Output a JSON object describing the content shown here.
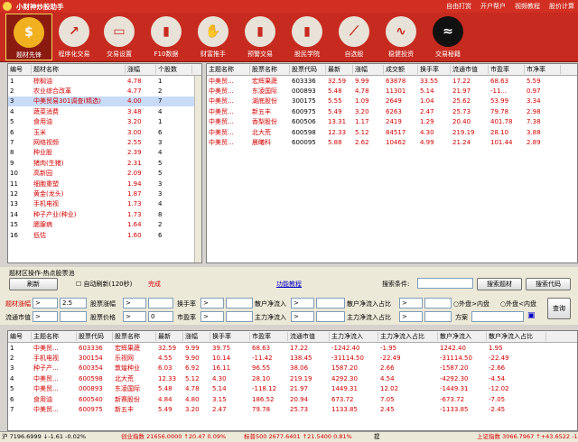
{
  "app": {
    "title": "小财神炒股助手",
    "links": [
      "自由打赏",
      "开户帮户",
      "视频教程",
      "股价计算"
    ]
  },
  "toolbar": [
    {
      "label": "题材先锋",
      "icon": "coin-icon",
      "active": true
    },
    {
      "label": "程序化交易",
      "icon": "chart-icon"
    },
    {
      "label": "交易设置",
      "icon": "monitor-icon"
    },
    {
      "label": "F10数据",
      "icon": "bar-chart-icon"
    },
    {
      "label": "财富推手",
      "icon": "hands-icon"
    },
    {
      "label": "预警交易",
      "icon": "bar-chart-icon"
    },
    {
      "label": "股民学院",
      "icon": "bar-chart-icon"
    },
    {
      "label": "自选股",
      "icon": "line-chart-icon"
    },
    {
      "label": "稳健投资",
      "icon": "pulse-icon"
    },
    {
      "label": "交易秘籍",
      "icon": "dark-chart-icon"
    }
  ],
  "left_table": {
    "headers": [
      "编号",
      "题材名称",
      "涨幅",
      "个股数"
    ],
    "rows": [
      [
        "1",
        "棕榈油",
        "4.78",
        "1"
      ],
      [
        "2",
        "农业综合改革",
        "4.77",
        "2"
      ],
      [
        "3",
        "中美贸易301调查(精选)",
        "4.00",
        "7"
      ],
      [
        "4",
        "蔬菜消费",
        "3.48",
        "4"
      ],
      [
        "5",
        "食用油",
        "3.20",
        "1"
      ],
      [
        "6",
        "玉米",
        "3.00",
        "6"
      ],
      [
        "7",
        "网络视频",
        "2.55",
        "3"
      ],
      [
        "8",
        "种业股",
        "2.39",
        "4"
      ],
      [
        "9",
        "猪肉(生猪)",
        "2.31",
        "5"
      ],
      [
        "10",
        "高新园",
        "2.09",
        "5"
      ],
      [
        "11",
        "细胞重塑",
        "1.94",
        "3"
      ],
      [
        "12",
        "黄金(龙头)",
        "1.87",
        "3"
      ],
      [
        "13",
        "手机电视",
        "1.73",
        "4"
      ],
      [
        "14",
        "种子产业(种业)",
        "1.73",
        "8"
      ],
      [
        "15",
        "腮腺病",
        "1.64",
        "2"
      ],
      [
        "16",
        "低估",
        "1.60",
        "6"
      ]
    ]
  },
  "right_table": {
    "headers": [
      "主题名称",
      "股票名称",
      "股票代码",
      "最新",
      "涨幅",
      "成交额",
      "换手率",
      "流通市值",
      "市盈率",
      "市净率"
    ],
    "rows": [
      [
        "中美贸...",
        "宏辉果蔬",
        "603336",
        "32.59",
        "9.99",
        "63878",
        "33.55",
        "17.22",
        "68.63",
        "5.59"
      ],
      [
        "中美贸...",
        "东凌国际",
        "000893",
        "5.48",
        "4.78",
        "11301",
        "5.14",
        "21.97",
        "-11...",
        "0.97"
      ],
      [
        "中美贸...",
        "湖底股份",
        "300175",
        "5.55",
        "1.09",
        "2649",
        "1.04",
        "25.62",
        "53.99",
        "3.34"
      ],
      [
        "中美贸...",
        "新五丰",
        "600975",
        "5.49",
        "3.20",
        "6263",
        "2.47",
        "25.73",
        "79.78",
        "2.98"
      ],
      [
        "中美贸...",
        "香梨股份",
        "600506",
        "13.31",
        "1.17",
        "2419",
        "1.29",
        "20.40",
        "401.78",
        "7.38"
      ],
      [
        "中美贸...",
        "北大荒",
        "600598",
        "12.33",
        "5.12",
        "84517",
        "4.30",
        "219.19",
        "28.10",
        "3.88"
      ],
      [
        "中美贸...",
        "晨曦科",
        "600095",
        "5.88",
        "2.62",
        "10462",
        "4.99",
        "21.24",
        "101.44",
        "2.89"
      ]
    ]
  },
  "controls": {
    "group_label": "题材区操作-热点股票池",
    "refresh": "刷新",
    "auto_refresh": "自动刷新(120秒)",
    "done": "完成",
    "func_desc": "功能教程",
    "search_label": "搜索条件:",
    "search_topic": "搜索题材",
    "search_code": "搜索代码",
    "query": "查询",
    "scheme": "方案"
  },
  "filters": {
    "row1": [
      "题材涨幅",
      "股票涨幅",
      "换手率",
      "散户净流入",
      "散户净流入占比"
    ],
    "row2": [
      "流通市值",
      "股票价格",
      "市盈率",
      "主力净流入",
      "主力净流入占比"
    ],
    "op": ">",
    "val": "2.5",
    "zero": "0",
    "ext": "外盘>内盘",
    "ext2": "外盘<内盘"
  },
  "bottom_table": {
    "headers": [
      "编号",
      "主题名称",
      "股票代码",
      "股票名称",
      "最新",
      "涨幅",
      "换手率",
      "市盈率",
      "流通市值",
      "主力净流入",
      "主力净流入占比",
      "散户净流入",
      "散户净流入占比"
    ],
    "rows": [
      [
        "1",
        "中美贸...",
        "603336",
        "宏辉果蔬",
        "32.59",
        "9.99",
        "39.75",
        "68.63",
        "17.22",
        "-1242.40",
        "-1.95",
        "1242.40",
        "1.95"
      ],
      [
        "2",
        "手机电视",
        "300154",
        "乐视网",
        "4.55",
        "9.90",
        "10.14",
        "-11.42",
        "138.45",
        "-31114.50",
        "-22.49",
        "-31114.50",
        "-22.49"
      ],
      [
        "3",
        "种子产...",
        "600354",
        "敦煌种业",
        "6.03",
        "6.92",
        "16.11",
        "96.55",
        "38.06",
        "1587.20",
        "2.66",
        "-1587.20",
        "-2.66"
      ],
      [
        "4",
        "中美贸...",
        "600598",
        "北大荒",
        "12.33",
        "5.12",
        "4.30",
        "28.10",
        "219.19",
        "4292.30",
        "4.54",
        "-4292.30",
        "-4.54"
      ],
      [
        "5",
        "中美贸...",
        "000893",
        "东凌国际",
        "5.48",
        "4.78",
        "5.14",
        "-118.12",
        "21.97",
        "1449.31",
        "12.02",
        "-1449.31",
        "-12.02"
      ],
      [
        "6",
        "食用油",
        "600540",
        "新赛股份",
        "4.84",
        "4.80",
        "3.15",
        "186.52",
        "20.94",
        "673.72",
        "7.05",
        "-673.72",
        "-7.05"
      ],
      [
        "7",
        "中美贸...",
        "600975",
        "新五丰",
        "5.49",
        "3.20",
        "2.47",
        "79.78",
        "25.73",
        "1133.85",
        "2.45",
        "-1133.85",
        "-2.45"
      ]
    ]
  },
  "status": {
    "sh": "沪 7196.6999 ↓-1.61 -0.02%",
    "sz": "创业指数 21656.0000 ↑20.47 0.09%",
    "cy": "标普500 2677.6401 ↑21.5400 0.81%",
    "msg": "提",
    "ex": "上证指数 3066.7967 ↑+43.6522 -1"
  },
  "colors": {
    "accent": "#c72a1f",
    "up": "#d20000",
    "selection": "#c8dcf8"
  }
}
